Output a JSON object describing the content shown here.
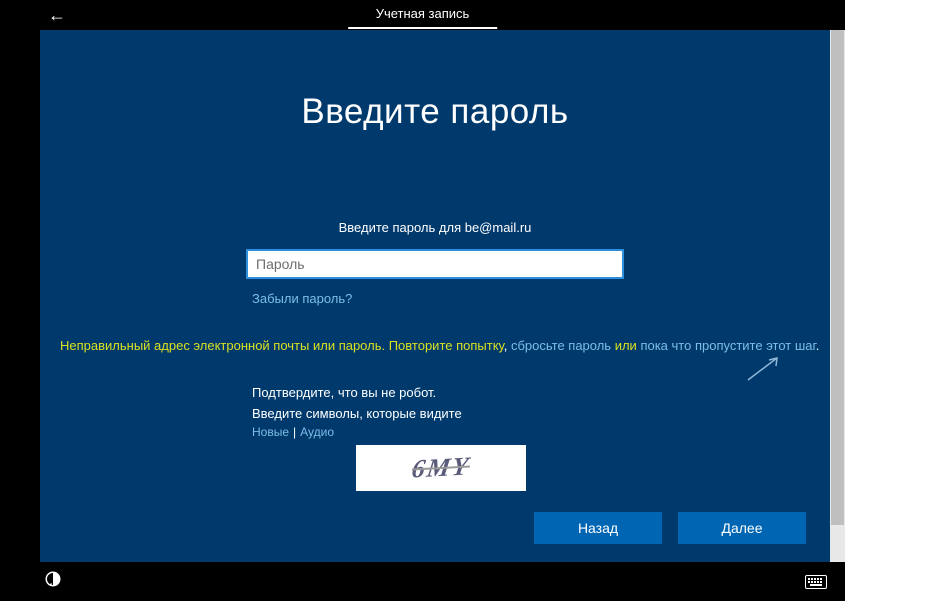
{
  "topbar": {
    "tab_label": "Учетная запись"
  },
  "heading": "Введите пароль",
  "prompt": "Введите пароль для be@mail.ru",
  "password": {
    "placeholder": "Пароль",
    "value": ""
  },
  "forgot_label": "Забыли пароль?",
  "error": {
    "part1": "Неправильный адрес электронной почты или пароль. Повторите попытку",
    "sep1": ", ",
    "link_reset": "сбросьте пароль",
    "sep2": " или ",
    "link_skip": "пока что пропустите этот шаг",
    "period": "."
  },
  "captcha": {
    "confirm_label": "Подтвердите, что вы не робот.",
    "instruction": "Введите символы, которые видите",
    "new_label": "Новые",
    "audio_label": "Аудио",
    "image_text": "6MY"
  },
  "buttons": {
    "back": "Назад",
    "next": "Далее"
  }
}
